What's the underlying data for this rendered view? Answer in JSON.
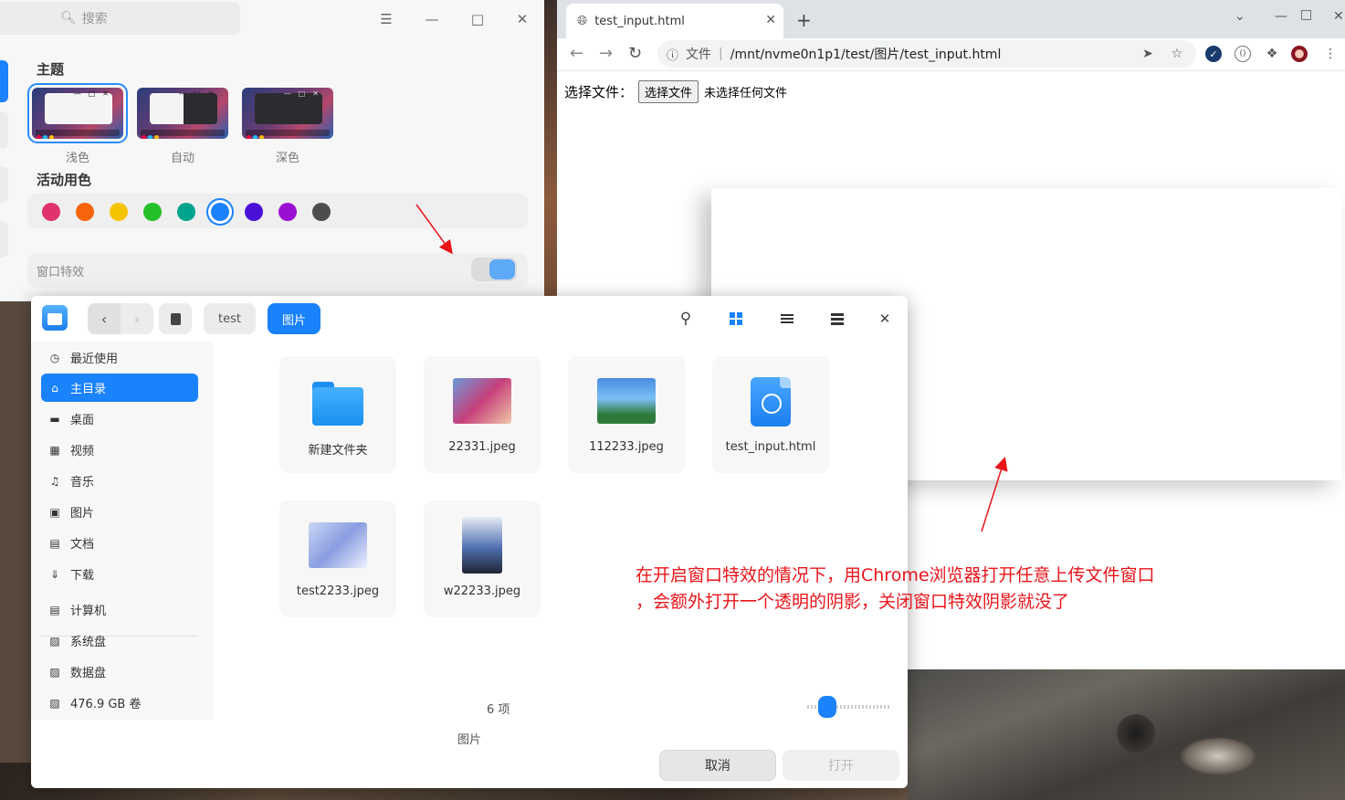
{
  "settings": {
    "search_placeholder": "搜索",
    "theme_title": "主题",
    "themes": [
      {
        "label": "浅色",
        "selected": true
      },
      {
        "label": "自动",
        "selected": false
      },
      {
        "label": "深色",
        "selected": false
      }
    ],
    "accent_title": "活动用色",
    "accent_colors": [
      "#e0336c",
      "#f5640b",
      "#f5c400",
      "#24bf2a",
      "#00a48c",
      "#1a82fa",
      "#4b10d8",
      "#9b0fd4",
      "#4d4d4d"
    ],
    "accent_selected": "#1a82fa",
    "window_effects_label": "窗口特效",
    "window_effects_on": true
  },
  "chrome": {
    "tab_title": "test_input.html",
    "address_scheme": "文件",
    "address_path": "/mnt/nvme0n1p1/test/图片/test_input.html",
    "page_label": "选择文件：",
    "choose_button": "选择文件",
    "no_file_text": "未选择任何文件"
  },
  "dialog": {
    "breadcrumbs": [
      "test",
      "图片"
    ],
    "sidebar": [
      {
        "label": "最近使用",
        "icon": "clock-icon"
      },
      {
        "label": "主目录",
        "icon": "home-icon",
        "active": true
      },
      {
        "label": "桌面",
        "icon": "desktop-icon"
      },
      {
        "label": "视频",
        "icon": "video-icon"
      },
      {
        "label": "音乐",
        "icon": "music-icon"
      },
      {
        "label": "图片",
        "icon": "image-icon"
      },
      {
        "label": "文档",
        "icon": "document-icon"
      },
      {
        "label": "下载",
        "icon": "download-icon"
      },
      {
        "label": "计算机",
        "icon": "computer-icon"
      },
      {
        "label": "系统盘",
        "icon": "disk-icon"
      },
      {
        "label": "数据盘",
        "icon": "disk-icon"
      },
      {
        "label": "476.9 GB 卷",
        "icon": "disk-icon"
      }
    ],
    "files": [
      {
        "name": "新建文件夹",
        "kind": "folder"
      },
      {
        "name": "22331.jpeg",
        "kind": "image"
      },
      {
        "name": "112233.jpeg",
        "kind": "image"
      },
      {
        "name": "test_input.html",
        "kind": "html"
      },
      {
        "name": "test2233.jpeg",
        "kind": "image"
      },
      {
        "name": "w22233.jpeg",
        "kind": "image"
      }
    ],
    "item_count": "6 项",
    "file_type": "图片",
    "cancel_label": "取消",
    "open_label": "打开"
  },
  "annotation": {
    "line1": "在开启窗口特效的情况下，用Chrome浏览器打开任意上传文件窗口",
    "line2": "，会额外打开一个透明的阴影，关闭窗口特效阴影就没了",
    "color": "#e8141a"
  }
}
